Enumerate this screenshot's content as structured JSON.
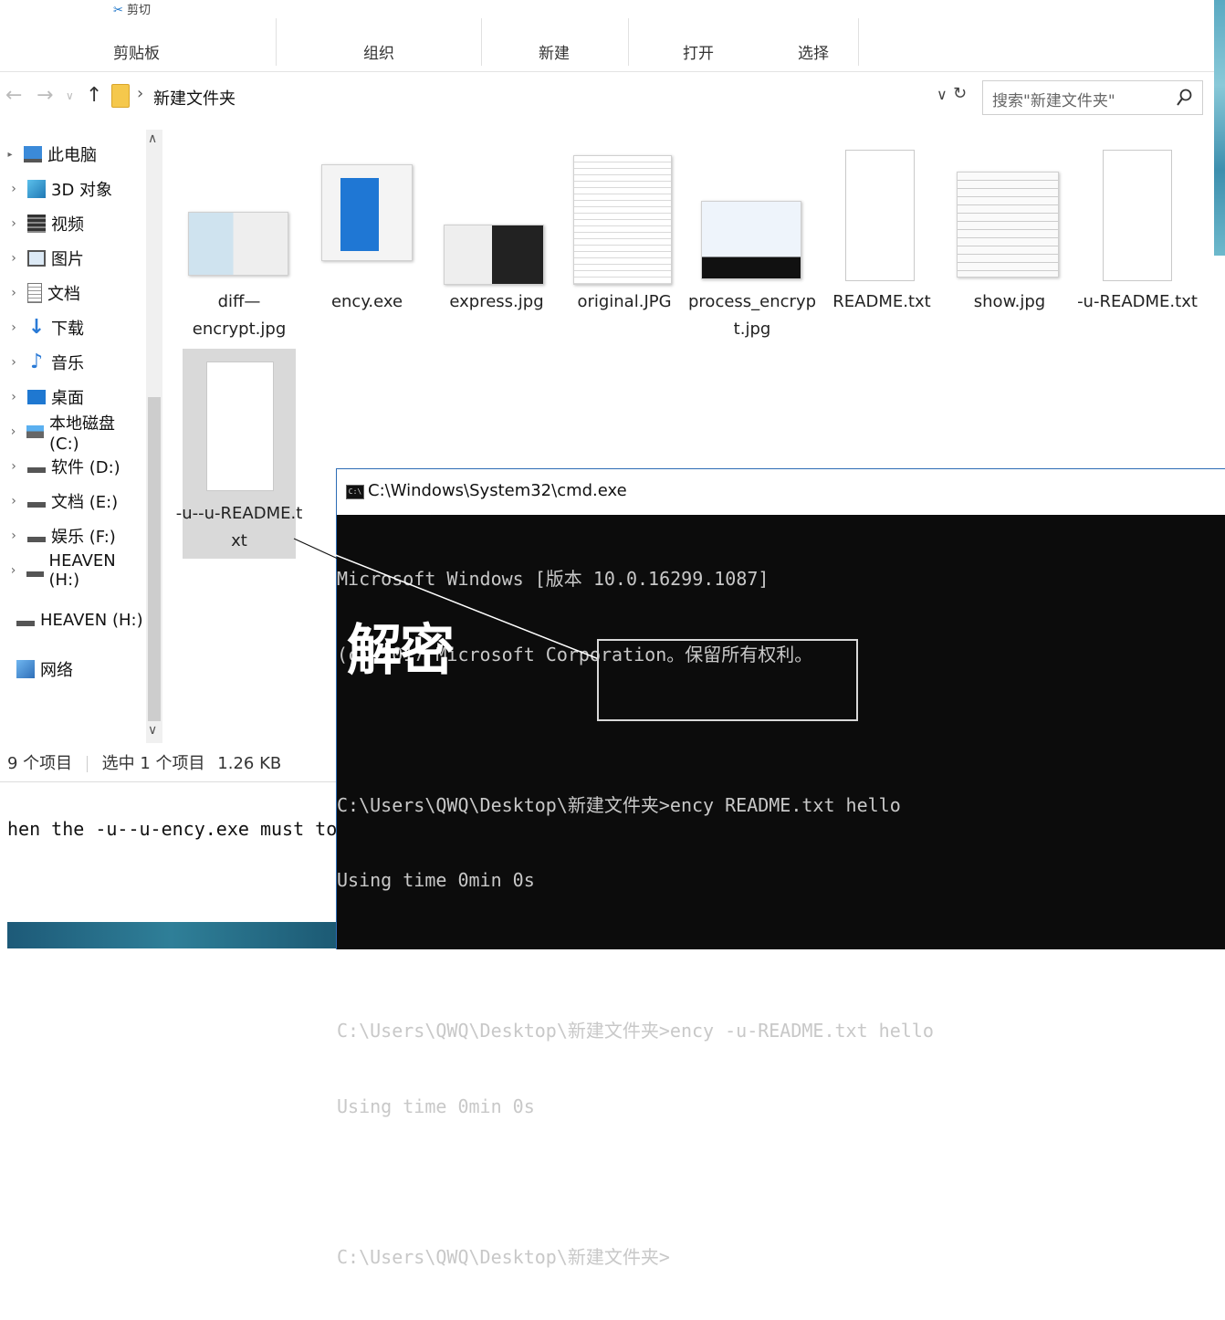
{
  "ribbon": {
    "cut_top_left": "剪切",
    "groups": [
      "剪贴板",
      "组织",
      "新建",
      "打开",
      "选择"
    ]
  },
  "addressbar": {
    "path": "新建文件夹",
    "search_placeholder": "搜索\"新建文件夹\""
  },
  "nav": {
    "items": [
      {
        "label": "此电脑",
        "icon": "computer-icon"
      },
      {
        "label": "3D 对象",
        "icon": "3d-objects-icon"
      },
      {
        "label": "视频",
        "icon": "video-icon"
      },
      {
        "label": "图片",
        "icon": "pictures-icon"
      },
      {
        "label": "文档",
        "icon": "documents-icon"
      },
      {
        "label": "下载",
        "icon": "download-icon"
      },
      {
        "label": "音乐",
        "icon": "music-icon"
      },
      {
        "label": "桌面",
        "icon": "desktop-icon"
      },
      {
        "label": "本地磁盘 (C:)",
        "icon": "drive-icon"
      },
      {
        "label": "软件 (D:)",
        "icon": "drive-icon"
      },
      {
        "label": "文档 (E:)",
        "icon": "drive-icon"
      },
      {
        "label": "娱乐 (F:)",
        "icon": "drive-icon"
      },
      {
        "label": "HEAVEN (H:)",
        "icon": "drive-icon"
      }
    ],
    "extra": [
      {
        "label": "HEAVEN (H:)",
        "icon": "usb-drive-icon"
      },
      {
        "label": "网络",
        "icon": "network-icon"
      }
    ]
  },
  "files": [
    {
      "name1": "diff—",
      "name2": "encrypt.jpg"
    },
    {
      "name1": "ency.exe",
      "name2": ""
    },
    {
      "name1": "express.jpg",
      "name2": ""
    },
    {
      "name1": "original.JPG",
      "name2": ""
    },
    {
      "name1": "process_encryp",
      "name2": "t.jpg"
    },
    {
      "name1": "README.txt",
      "name2": ""
    },
    {
      "name1": "show.jpg",
      "name2": ""
    },
    {
      "name1": "-u-README.txt",
      "name2": ""
    },
    {
      "name1": "-u--u-README.t",
      "name2": "xt"
    }
  ],
  "status": {
    "count": "9 个项目",
    "selected": "选中 1 个项目",
    "size": "1.26 KB"
  },
  "cmd": {
    "title": "C:\\Windows\\System32\\cmd.exe",
    "lines": [
      "Microsoft Windows [版本 10.0.16299.1087]",
      "(c) 2017 Microsoft Corporation。保留所有权利。",
      "",
      "C:\\Users\\QWQ\\Desktop\\新建文件夹>ency README.txt hello",
      "Using time 0min 0s",
      "",
      "C:\\Users\\QWQ\\Desktop\\新建文件夹>ency -u-README.txt hello",
      "Using time 0min 0s",
      "",
      "C:\\Users\\QWQ\\Desktop\\新建文件夹>"
    ]
  },
  "annotation": {
    "label": "解密"
  },
  "background_text": "hen the -u--u-ency.exe must to be the"
}
